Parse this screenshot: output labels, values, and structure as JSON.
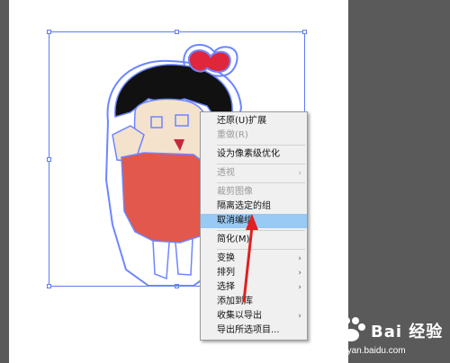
{
  "context_menu": {
    "items": [
      {
        "label": "还原(U)扩展",
        "enabled": true,
        "submenu": false
      },
      {
        "label": "重做(R)",
        "enabled": false,
        "submenu": false
      },
      {
        "label": "设为像素级优化",
        "enabled": true,
        "submenu": false
      },
      {
        "label": "透视",
        "enabled": false,
        "submenu": true
      },
      {
        "label": "裁剪图像",
        "enabled": false,
        "submenu": false
      },
      {
        "label": "隔离选定的组",
        "enabled": true,
        "submenu": false
      },
      {
        "label": "取消编组",
        "enabled": true,
        "submenu": false,
        "highlighted": true
      },
      {
        "label": "简化(M)",
        "enabled": true,
        "submenu": false
      },
      {
        "label": "变换",
        "enabled": true,
        "submenu": true
      },
      {
        "label": "排列",
        "enabled": true,
        "submenu": true
      },
      {
        "label": "选择",
        "enabled": true,
        "submenu": true
      },
      {
        "label": "添加到库",
        "enabled": true,
        "submenu": false
      },
      {
        "label": "收集以导出",
        "enabled": true,
        "submenu": true
      },
      {
        "label": "导出所选项目...",
        "enabled": true,
        "submenu": false
      }
    ],
    "submenu_arrow": "›"
  },
  "watermark": {
    "brand": "Bai 经验",
    "url": "jingyan.baidu.com"
  },
  "colors": {
    "canvas_bg": "#5a5a5a",
    "artboard": "#ffffff",
    "selection": "#5b7cf5",
    "highlight": "#99c9f5",
    "annotation_arrow": "#e02020"
  }
}
